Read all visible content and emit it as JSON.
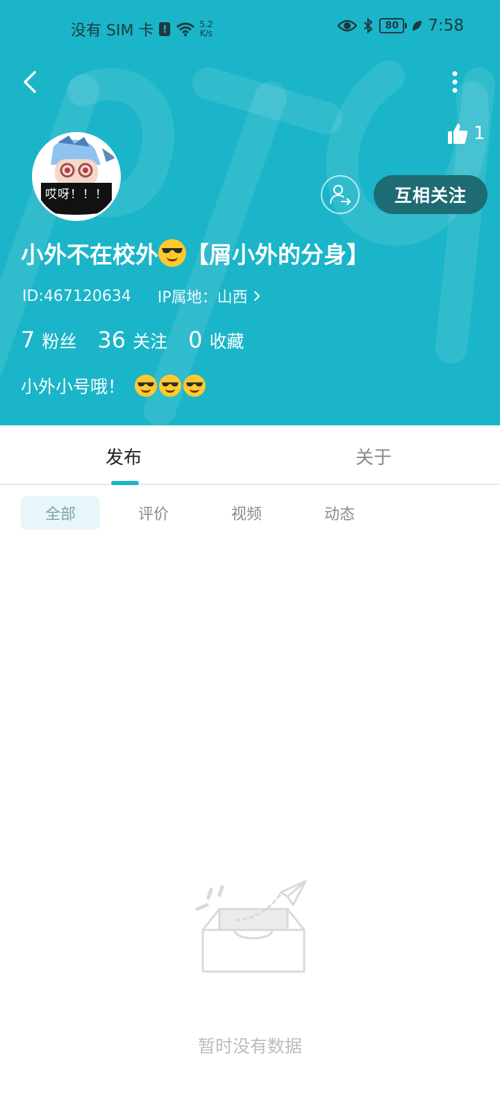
{
  "status_bar": {
    "carrier": "没有 SIM 卡",
    "sim_warning": "!",
    "speed_value": "5.2",
    "speed_unit": "K/s",
    "battery": "80",
    "time": "7:58"
  },
  "header": {
    "like_count": "1",
    "avatar_caption": "哎呀！！！",
    "follow_button": "互相关注",
    "name_part1": "小外不在校外",
    "name_part2": "【屑小外的分身】",
    "id_text": "ID:467120634",
    "ip_text": "IP属地：山西",
    "stats": [
      {
        "count": "7",
        "label": "粉丝"
      },
      {
        "count": "36",
        "label": "关注"
      },
      {
        "count": "0",
        "label": "收藏"
      }
    ],
    "bio": "小外小号哦！",
    "colors": {
      "header_bg": "#1ab5c8",
      "follow_bg": "#1f6b74",
      "emoji": "#ffca2e"
    }
  },
  "tabs": [
    {
      "label": "发布",
      "active": true
    },
    {
      "label": "关于",
      "active": false
    }
  ],
  "filters": [
    {
      "label": "全部",
      "active": true
    },
    {
      "label": "评价",
      "active": false
    },
    {
      "label": "视频",
      "active": false
    },
    {
      "label": "动态",
      "active": false
    }
  ],
  "empty_state": {
    "text": "暂时没有数据",
    "icon": "empty-inbox-icon"
  }
}
